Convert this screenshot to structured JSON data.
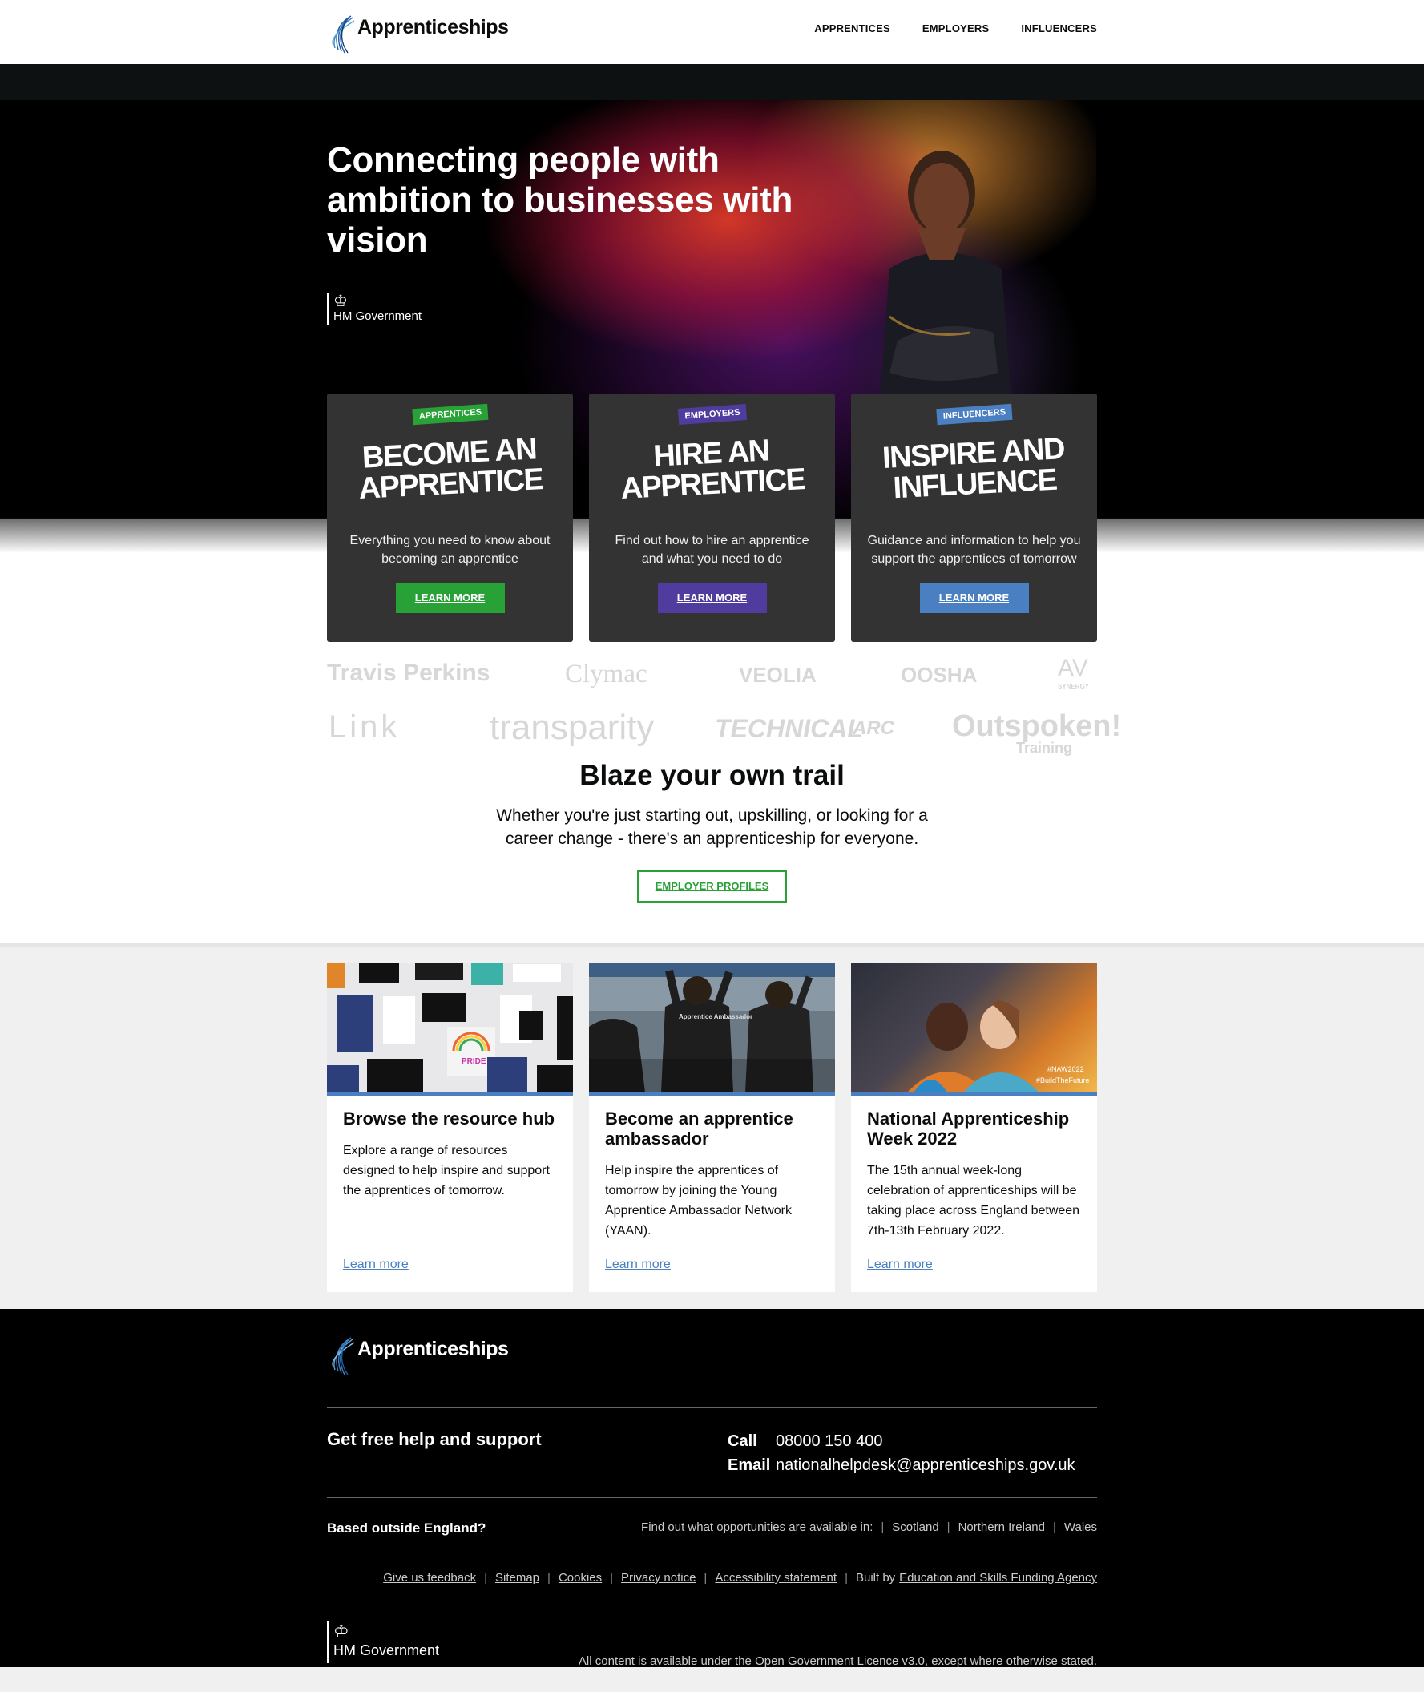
{
  "header": {
    "brand": "Apprenticeships",
    "nav": [
      "APPRENTICES",
      "EMPLOYERS",
      "INFLUENCERS"
    ]
  },
  "hero": {
    "title": "Connecting people with ambition to businesses with vision",
    "gov_label": "HM Government",
    "crest": "♔"
  },
  "cards": [
    {
      "tag": "APPRENTICES",
      "title": "BECOME AN APPRENTICE",
      "desc": "Everything you need to know about becoming an apprentice",
      "button": "LEARN MORE",
      "color": "#28a136"
    },
    {
      "tag": "EMPLOYERS",
      "title": "HIRE AN APPRENTICE",
      "desc": "Find out how to hire an apprentice and what you need to do",
      "button": "LEARN MORE",
      "color": "#4f3c9e"
    },
    {
      "tag": "INFLUENCERS",
      "title": "INSPIRE AND INFLUENCE",
      "desc": "Guidance and information to help you support the apprentices of tomorrow",
      "button": "LEARN MORE",
      "color": "#4a7fc1"
    }
  ],
  "logos": [
    "Travis Perkins",
    "Clymac",
    "VEOLIA",
    "OOSHA",
    "AV",
    "SYNERGY",
    "Link",
    "transparity",
    "TECHNICAL",
    "ARC",
    "Outspoken!",
    "Training"
  ],
  "blaze": {
    "heading": "Blaze your own trail",
    "text": "Whether you're just starting out, upskilling, or looking for a career change - there's an apprenticeship for everyone.",
    "button": "EMPLOYER PROFILES"
  },
  "resources": [
    {
      "title": "Browse the resource hub",
      "text": "Explore a range of resources designed to help inspire and support the apprentices of tomorrow.",
      "link": "Learn more",
      "img_text": "PRIDE"
    },
    {
      "title": "Become an apprentice ambassador",
      "text": "Help inspire the apprentices of tomorrow by joining the Young Apprentice Ambassador Network (YAAN).",
      "link": "Learn more",
      "img_text": "Apprentice Ambassador"
    },
    {
      "title": "National Apprenticeship Week 2022",
      "text": "The 15th annual week-long celebration of apprenticeships will be taking place across England between 7th-13th February 2022.",
      "link": "Learn more",
      "img_text": "#NAW2022",
      "img_text2": "#BuildTheFuture"
    }
  ],
  "footer": {
    "brand": "Apprenticeships",
    "help_heading": "Get free help and support",
    "call_label": "Call",
    "call_value": "08000 150 400",
    "email_label": "Email",
    "email_value": "nationalhelpdesk@apprenticeships.gov.uk",
    "outside_heading": "Based outside England?",
    "outside_text": "Find out what opportunities are available in:",
    "outside_links": [
      "Scotland",
      "Northern Ireland",
      "Wales"
    ],
    "links": [
      "Give us feedback",
      "Sitemap",
      "Cookies",
      "Privacy notice",
      "Accessibility statement"
    ],
    "built_by": "Built by",
    "built_by_link": "Education and Skills Funding Agency",
    "gov_label": "HM Government",
    "licence_pre": "All content is available under the",
    "licence_link": "Open Government Licence v3.0",
    "licence_post": ", except where otherwise stated."
  }
}
